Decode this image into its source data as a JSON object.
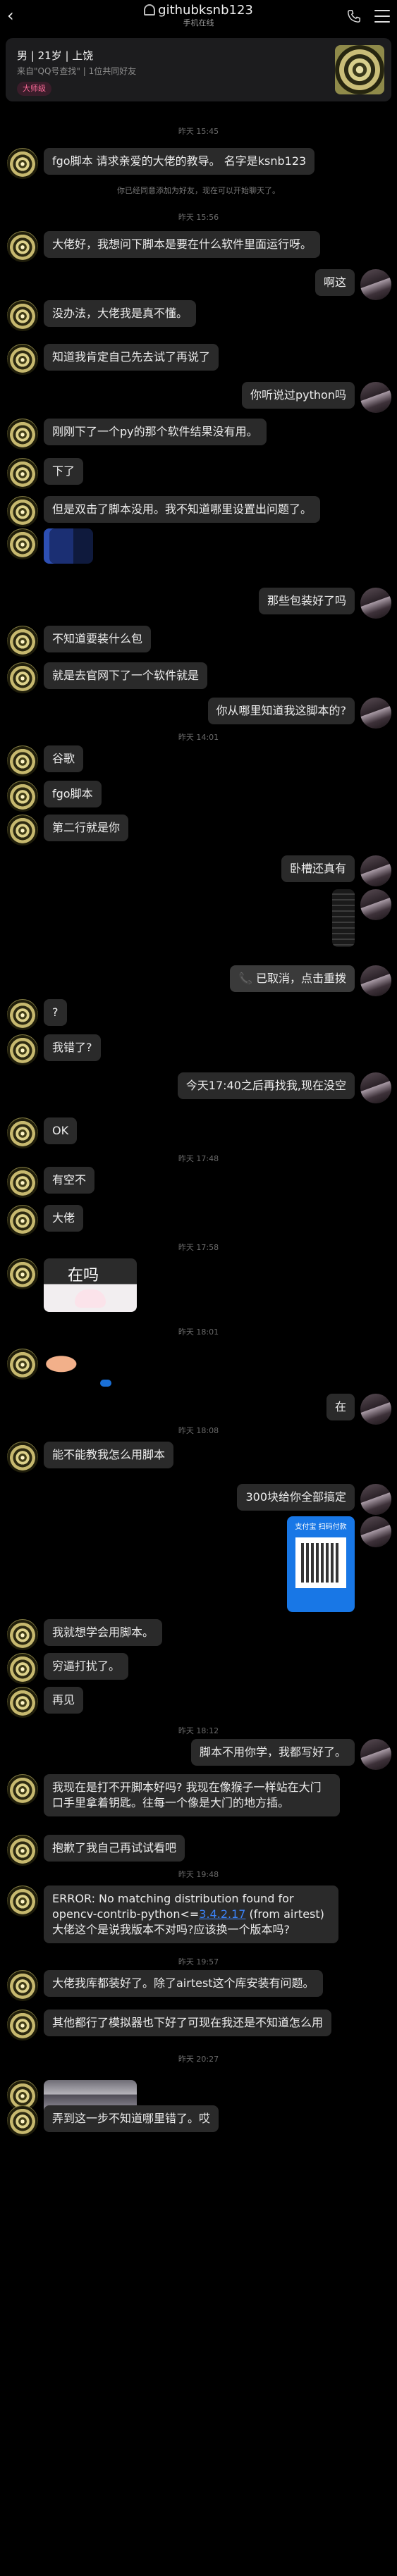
{
  "header": {
    "back_icon": "chevron-left-icon",
    "title": "githubksnb123",
    "subtitle": "手机在线",
    "phone_icon": "phone-icon",
    "menu_icon": "menu-icon"
  },
  "profile": {
    "info": "男  |  21岁  |  上饶",
    "source": "来自\"QQ号查找\"  |  1位共同好友",
    "tag": "大师级"
  },
  "messages": [
    {
      "type": "time",
      "text": "昨天 15:45"
    },
    {
      "type": "in",
      "text": "fgo脚本 请求亲爱的大佬的教导。 名字是ksnb123"
    },
    {
      "type": "sys",
      "text": "你已经同意添加为好友，现在可以开始聊天了。"
    },
    {
      "type": "time",
      "text": "昨天 15:56"
    },
    {
      "type": "in",
      "text": "大佬好，我想问下脚本是要在什么软件里面运行呀。"
    },
    {
      "type": "out",
      "text": "啊这"
    },
    {
      "type": "in",
      "text": "没办法，大佬我是真不懂。"
    },
    {
      "type": "in",
      "text": "知道我肯定自己先去试了再说了"
    },
    {
      "type": "out",
      "text": "你听说过python吗"
    },
    {
      "type": "in",
      "text": "刚刚下了一个py的那个软件结果没有用。"
    },
    {
      "type": "in",
      "text": "下了"
    },
    {
      "type": "in",
      "text": "但是双击了脚本没用。我不知道哪里设置出问题了。"
    },
    {
      "type": "in-image",
      "kind": "screenshot"
    },
    {
      "type": "out",
      "text": "那些包装好了吗"
    },
    {
      "type": "in",
      "text": "不知道要装什么包"
    },
    {
      "type": "in",
      "text": "就是去官网下了一个软件就是"
    },
    {
      "type": "out",
      "text": "你从哪里知道我这脚本的?"
    },
    {
      "type": "time",
      "text": "昨天 14:01"
    },
    {
      "type": "in",
      "text": "谷歌"
    },
    {
      "type": "in",
      "text": "fgo脚本"
    },
    {
      "type": "in",
      "text": "第二行就是你"
    },
    {
      "type": "out",
      "text": "卧槽还真有"
    },
    {
      "type": "out-image",
      "kind": "phone-screenshot"
    },
    {
      "type": "out-call",
      "text": "已取消，点击重拨",
      "icon": "phone-icon"
    },
    {
      "type": "in",
      "text": "?"
    },
    {
      "type": "in",
      "text": "我错了?"
    },
    {
      "type": "out",
      "text": "今天17:40之后再找我,现在没空"
    },
    {
      "type": "in",
      "text": "OK"
    },
    {
      "type": "time",
      "text": "昨天 17:48"
    },
    {
      "type": "in",
      "text": "有空不"
    },
    {
      "type": "in",
      "text": "大佬"
    },
    {
      "type": "time",
      "text": "昨天 17:58"
    },
    {
      "type": "in-sticker",
      "text": "在吗"
    },
    {
      "type": "time",
      "text": "昨天 18:01"
    },
    {
      "type": "in-emoji",
      "kind": "pointing-hand"
    },
    {
      "type": "out",
      "text": "在"
    },
    {
      "type": "time",
      "text": "昨天 18:08"
    },
    {
      "type": "in",
      "text": "能不能教我怎么用脚本"
    },
    {
      "type": "out",
      "text": "300块给你全部搞定"
    },
    {
      "type": "out-qr",
      "text": "支付宝 扫码付款"
    },
    {
      "type": "in",
      "text": "我就想学会用脚本。"
    },
    {
      "type": "in",
      "text": "穷逼打扰了。"
    },
    {
      "type": "in",
      "text": "再见"
    },
    {
      "type": "time",
      "text": "昨天 18:12"
    },
    {
      "type": "out",
      "text": "脚本不用你学，我都写好了。"
    },
    {
      "type": "in",
      "text": "我现在是打不开脚本好吗? 我现在像猴子一样站在大门口手里拿着钥匙。往每一个像是大门的地方插。"
    },
    {
      "type": "in",
      "text": "抱歉了我自己再试试看吧"
    },
    {
      "type": "time",
      "text": "昨天 19:48"
    },
    {
      "type": "in-error",
      "pre": "ERROR: No matching distribution found for opencv-contrib-python<=",
      "link": "3.4.2.17",
      "post": " (from airtest)大佬这个是说我版本不对吗?应该换一个版本吗?"
    },
    {
      "type": "time",
      "text": "昨天 19:57"
    },
    {
      "type": "in",
      "text": "大佬我库都装好了。除了airtest这个库安装有问题。"
    },
    {
      "type": "in",
      "text": "其他都行了模拟器也下好了可现在我还是不知道怎么用"
    },
    {
      "type": "time",
      "text": "昨天 20:27"
    },
    {
      "type": "in-image",
      "kind": "photo"
    },
    {
      "type": "in",
      "text": "弄到这一步不知道哪里错了。哎"
    }
  ]
}
